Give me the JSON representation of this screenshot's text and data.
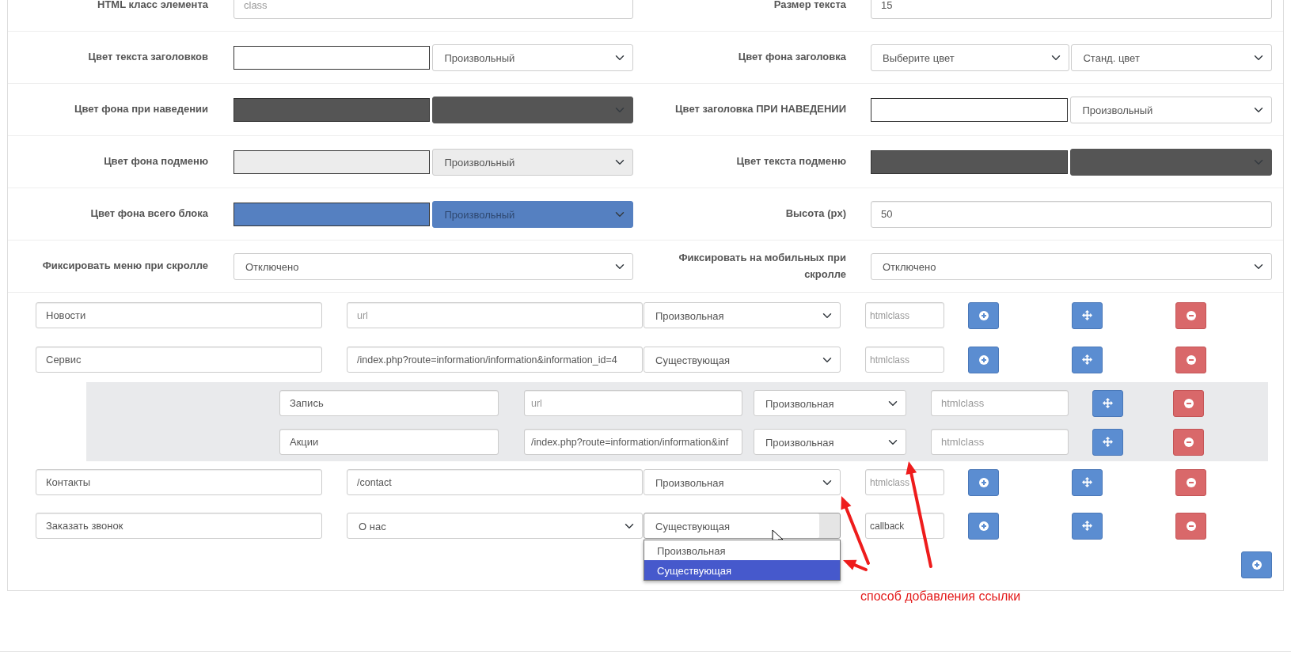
{
  "settings": [
    {
      "left": {
        "label": "HTML класс элемента",
        "control": {
          "kind": "text",
          "placeholder": "class"
        }
      },
      "right": {
        "label": "Размер текста",
        "control": {
          "kind": "text",
          "value": "15"
        }
      }
    },
    {
      "left": {
        "label": "Цвет текста заголовков",
        "control": {
          "kind": "color",
          "color": "#ffffff",
          "value": "Произвольный"
        }
      },
      "right": {
        "label": "Цвет фона заголовка",
        "control": {
          "kind": "select_pair",
          "values": [
            "Выберите цвет",
            "Станд. цвет"
          ]
        }
      }
    },
    {
      "left": {
        "label": "Цвет фона при наведении",
        "control": {
          "kind": "color",
          "color": "#555555"
        }
      },
      "right": {
        "label": "Цвет заголовка ПРИ НАВЕДЕНИИ",
        "control": {
          "kind": "color",
          "color": "#ffffff",
          "value": "Произвольный"
        }
      }
    },
    {
      "left": {
        "label": "Цвет фона подменю",
        "control": {
          "kind": "color",
          "color": "#ececec",
          "value": "Произвольный"
        }
      },
      "right": {
        "label": "Цвет текста подменю",
        "control": {
          "kind": "color",
          "color": "#555555"
        }
      }
    },
    {
      "left": {
        "label": "Цвет фона всего блока",
        "control": {
          "kind": "color",
          "color": "#5580c1",
          "value": "Произвольный"
        }
      },
      "right": {
        "label": "Высота (px)",
        "control": {
          "kind": "text",
          "value": "50"
        }
      }
    },
    {
      "left": {
        "label": "Фиксировать меню при скролле",
        "control": {
          "kind": "select",
          "value": "Отключено"
        }
      },
      "right": {
        "label": "Фиксировать на мобильных при скролле",
        "control": {
          "kind": "select",
          "value": "Отключено"
        }
      }
    }
  ],
  "menu_items": [
    {
      "name": "Новости",
      "url": {
        "kind": "text",
        "placeholder": "url"
      },
      "link_type": {
        "value": "Произвольная",
        "open": false
      },
      "html_class": {
        "placeholder": "htmlclass"
      },
      "actions": [
        {
          "kind": "add"
        },
        {
          "kind": "move"
        },
        {
          "kind": "remove"
        }
      ]
    },
    {
      "name": "Сервис",
      "url": {
        "kind": "text",
        "value": "/index.php?route=information/information&information_id=4"
      },
      "link_type": {
        "value": "Существующая",
        "open": false
      },
      "html_class": {
        "placeholder": "htmlclass"
      },
      "actions": [
        {
          "kind": "add"
        },
        {
          "kind": "move"
        },
        {
          "kind": "remove"
        }
      ],
      "children": [
        {
          "name": "Запись",
          "url": {
            "kind": "text",
            "placeholder": "url"
          },
          "link_type": {
            "value": "Произвольная",
            "open": false
          },
          "html_class": {
            "placeholder": "htmlclass"
          },
          "actions": [
            {
              "kind": "move"
            },
            {
              "kind": "remove"
            }
          ]
        },
        {
          "name": "Акции",
          "url": {
            "kind": "text",
            "value": "/index.php?route=information/information&inf"
          },
          "link_type": {
            "value": "Произвольная",
            "open": false
          },
          "html_class": {
            "placeholder": "htmlclass"
          },
          "actions": [
            {
              "kind": "move"
            },
            {
              "kind": "remove"
            }
          ]
        }
      ]
    },
    {
      "name": "Контакты",
      "url": {
        "kind": "text",
        "value": "/contact"
      },
      "link_type": {
        "value": "Произвольная",
        "open": false
      },
      "html_class": {
        "placeholder": "htmlclass"
      },
      "actions": [
        {
          "kind": "add"
        },
        {
          "kind": "move"
        },
        {
          "kind": "remove"
        }
      ]
    },
    {
      "name": "Заказать звонок",
      "url": {
        "kind": "select",
        "value": "О нас"
      },
      "link_type": {
        "value": "Существующая",
        "open": true,
        "options": [
          {
            "label": "Произвольная",
            "selected": false
          },
          {
            "label": "Существующая",
            "selected": true
          }
        ]
      },
      "html_class": {
        "value": "callback"
      },
      "actions": [
        {
          "kind": "add"
        },
        {
          "kind": "move"
        },
        {
          "kind": "remove"
        }
      ]
    }
  ],
  "annotation": {
    "text": "способ добавления ссылки"
  }
}
